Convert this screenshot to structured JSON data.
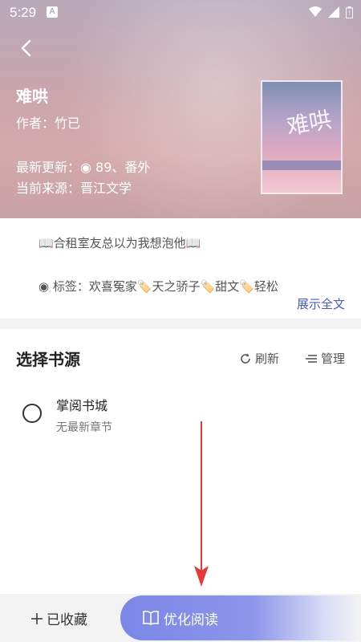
{
  "status": {
    "time": "5:29",
    "badge": "A"
  },
  "book": {
    "title": "难哄",
    "author": "作者：竹已",
    "latest_update": "最新更新：◉ 89、番外",
    "current_source": "当前来源：晋江文学",
    "cover_text": "难哄"
  },
  "intro": {
    "summary": "📖合租室友总以为我想泡他📖",
    "tags": "◉ 标签：欢喜冤家🏷️天之骄子🏷️甜文🏷️轻松",
    "show_all": "展示全文"
  },
  "sources": {
    "title": "选择书源",
    "refresh": "刷新",
    "manage": "管理",
    "items": [
      {
        "name": "掌阅书城",
        "latest": "无最新章节"
      }
    ]
  },
  "bottom": {
    "collect": "已收藏",
    "read": "优化阅读"
  },
  "colors": {
    "accent": "#4a5bc7",
    "read_button": "#7b87e6",
    "annotation_arrow": "#e53935"
  }
}
